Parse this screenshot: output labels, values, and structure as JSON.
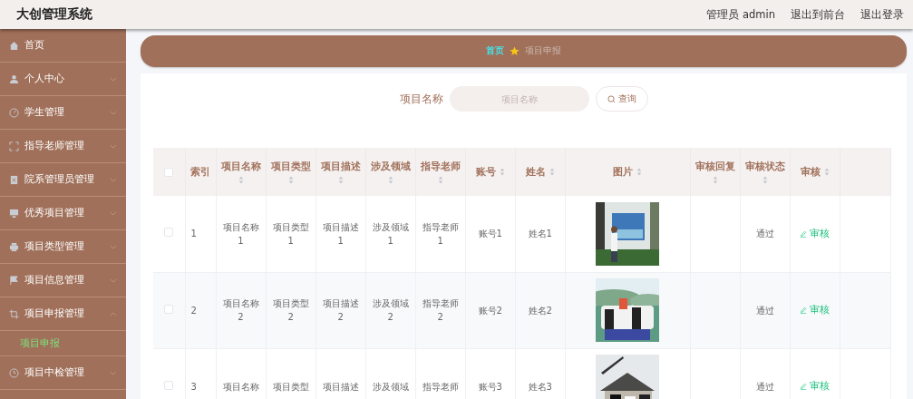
{
  "header": {
    "title": "大创管理系统",
    "user": "管理员 admin",
    "links": [
      "退出到前台",
      "退出登录"
    ]
  },
  "sidebar": {
    "items": [
      {
        "label": "首页"
      },
      {
        "label": "个人中心",
        "expanded": false
      },
      {
        "label": "学生管理",
        "expanded": false
      },
      {
        "label": "指导老师管理",
        "expanded": false
      },
      {
        "label": "院系管理员管理",
        "expanded": false
      },
      {
        "label": "优秀项目管理",
        "expanded": false
      },
      {
        "label": "项目类型管理",
        "expanded": false
      },
      {
        "label": "项目信息管理",
        "expanded": false
      },
      {
        "label": "项目申报管理",
        "expanded": true,
        "children": [
          {
            "label": "项目申报",
            "selected": true
          }
        ]
      },
      {
        "label": "项目中检管理",
        "expanded": false
      }
    ]
  },
  "breadcrumb": [
    "首页",
    "项目申报"
  ],
  "search": {
    "label": "项目名称",
    "placeholder": "项目名称",
    "button": "查询"
  },
  "table": {
    "select_all": {
      "checked": false
    },
    "columns": [
      {
        "label": "索引",
        "sortable": false
      },
      {
        "label": "项目名称",
        "sortable": true
      },
      {
        "label": "项目类型",
        "sortable": true
      },
      {
        "label": "项目描述",
        "sortable": true
      },
      {
        "label": "涉及领域",
        "sortable": true
      },
      {
        "label": "指导老师",
        "sortable": true
      },
      {
        "label": "账号",
        "sortable": true
      },
      {
        "label": "姓名",
        "sortable": true
      },
      {
        "label": "图片",
        "sortable": true
      },
      {
        "label": "审核回复",
        "sortable": true
      },
      {
        "label": "审核状态",
        "sortable": true
      },
      {
        "label": "审核",
        "sortable": true
      }
    ],
    "rows": [
      {
        "selected": false,
        "cells": [
          "1",
          "项目名称1",
          "项目类型1",
          "项目描述1",
          "涉及领域1",
          "指导老师1",
          "账号1",
          "姓名1"
        ],
        "status": "通过",
        "action": "审核"
      },
      {
        "selected": false,
        "cells": [
          "2",
          "项目名称2",
          "项目类型2",
          "项目描述2",
          "涉及领域2",
          "指导老师2",
          "账号2",
          "姓名2"
        ],
        "status": "通过",
        "action": "审核"
      },
      {
        "selected": false,
        "cells": [
          "3",
          "项目名称",
          "项目类型",
          "项目描述",
          "涉及领域",
          "指导老师",
          "账号3",
          "姓名3"
        ],
        "status": "通过",
        "action": "审核"
      }
    ]
  }
}
